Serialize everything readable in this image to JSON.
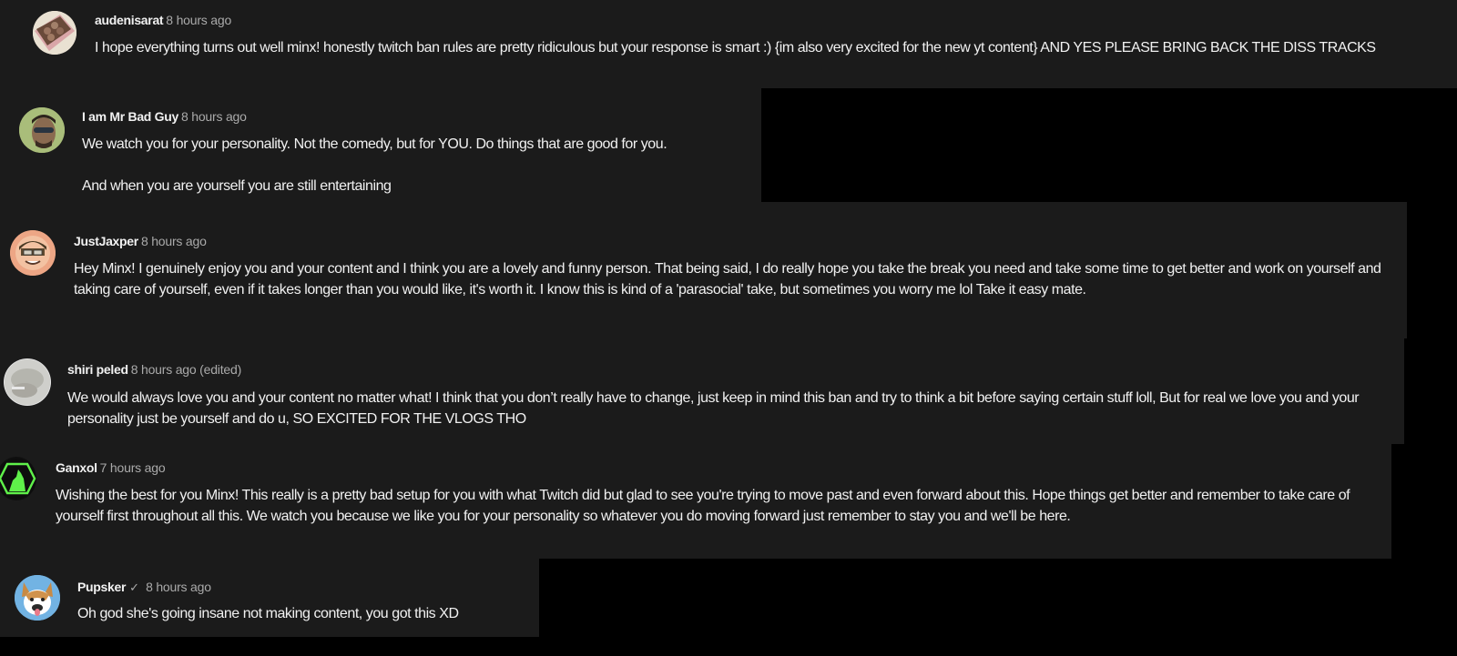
{
  "comments": [
    {
      "author": "audenisarat",
      "time": "8 hours ago",
      "text": "I hope everything turns out well minx! honestly twitch ban rules are pretty ridiculous but your response is smart :) {im also very excited for the new yt content} AND YES PLEASE BRING BACK THE DISS TRACKS"
    },
    {
      "author": "I am Mr Bad Guy",
      "time": "8 hours ago",
      "text": "We watch you for your personality. Not the comedy, but for YOU. Do things that are good for you.\n\nAnd when you are yourself you are still entertaining"
    },
    {
      "author": "JustJaxper",
      "time": "8 hours ago",
      "text": "Hey Minx! I genuinely enjoy you and your content and I think you are a lovely and funny person. That being said, I do really hope you take the break you need and take some time to get better and work on yourself and taking care of yourself, even if it takes longer than you would like, it's worth it. I know this is kind of a 'parasocial' take, but sometimes you worry me lol Take it easy mate."
    },
    {
      "author": "shiri peled",
      "time": "8 hours ago (edited)",
      "text": "We would always love you and your content no matter what! I think that you don’t really have to change, just keep in mind this ban and try to think a bit before saying certain stuff loll, But for real we love you and your personality just be yourself and do u, SO EXCITED FOR THE VLOGS THO"
    },
    {
      "author": "Ganxol",
      "time": "7 hours ago",
      "text": "Wishing the best for you Minx! This really is a pretty bad setup for you with what Twitch did but glad to see you're trying to move past and even forward about this. Hope things get better and remember to take care of yourself first throughout all this. We watch you because we like you for your personality so whatever you do moving forward just remember to stay you and we'll be here."
    },
    {
      "author": "Pupsker",
      "verified": "✓",
      "time": "8 hours ago",
      "text": "Oh god she's going insane not making content, you got this XD"
    }
  ],
  "avatars": {
    "chocolates": "chocolate-box-avatar",
    "sunglasses_man": "man-sunglasses-avatar",
    "cartoon_face": "cartoon-face-avatar",
    "blurry_photo": "blurry-photo-avatar",
    "wolf": "howling-wolf-avatar",
    "corgi": "corgi-avatar"
  },
  "colors": {
    "background": "#000000",
    "panel": "#1b1b1b",
    "text": "#f1f1f1",
    "meta": "#aaaaaa",
    "wolf_green": "#5ff04a"
  }
}
